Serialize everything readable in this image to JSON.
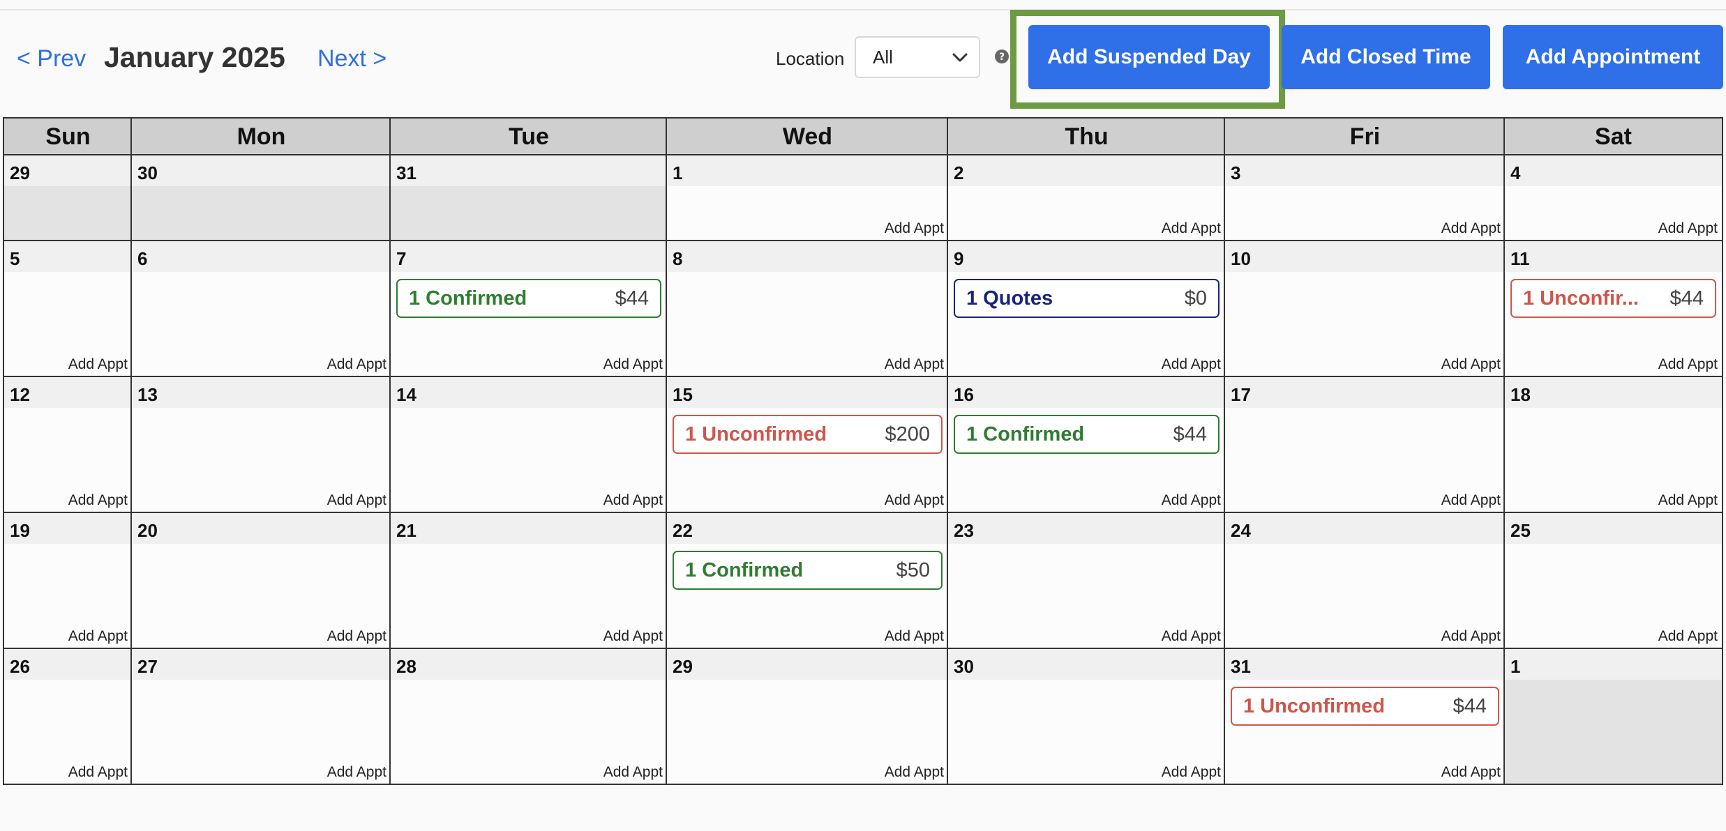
{
  "toolbar": {
    "prev_label": "< Prev",
    "month_title": "January 2025",
    "next_label": "Next >",
    "location_label": "Location",
    "location_value": "All",
    "help_icon": "question-circle-icon",
    "add_suspended_day_label": "Add Suspended Day",
    "add_closed_time_label": "Add Closed Time",
    "add_appointment_label": "Add Appointment"
  },
  "colors": {
    "primary_button": "#2f6fe8",
    "highlight_frame": "#6e9a43",
    "confirmed": "#2e7d32",
    "quotes": "#1a237e",
    "unconfirmed": "#d0554a",
    "link": "#2f6fe0"
  },
  "calendar": {
    "weekdays": [
      "Sun",
      "Mon",
      "Tue",
      "Wed",
      "Thu",
      "Fri",
      "Sat"
    ],
    "add_appt_label": "Add Appt",
    "weeks": [
      [
        {
          "day": "29",
          "outside": true
        },
        {
          "day": "30",
          "outside": true
        },
        {
          "day": "31",
          "outside": true
        },
        {
          "day": "1",
          "outside": false
        },
        {
          "day": "2",
          "outside": false
        },
        {
          "day": "3",
          "outside": false
        },
        {
          "day": "4",
          "outside": false
        }
      ],
      [
        {
          "day": "5",
          "outside": false
        },
        {
          "day": "6",
          "outside": false
        },
        {
          "day": "7",
          "outside": false,
          "event": {
            "status": "confirmed",
            "label": "1 Confirmed",
            "amount": "$44"
          }
        },
        {
          "day": "8",
          "outside": false
        },
        {
          "day": "9",
          "outside": false,
          "event": {
            "status": "quotes",
            "label": "1 Quotes",
            "amount": "$0"
          }
        },
        {
          "day": "10",
          "outside": false
        },
        {
          "day": "11",
          "outside": false,
          "event": {
            "status": "unconfirmed",
            "label": "1 Unconfir...",
            "amount": "$44"
          }
        }
      ],
      [
        {
          "day": "12",
          "outside": false
        },
        {
          "day": "13",
          "outside": false
        },
        {
          "day": "14",
          "outside": false
        },
        {
          "day": "15",
          "outside": false,
          "event": {
            "status": "unconfirmed",
            "label": "1 Unconfirmed",
            "amount": "$200"
          }
        },
        {
          "day": "16",
          "outside": false,
          "event": {
            "status": "confirmed",
            "label": "1 Confirmed",
            "amount": "$44"
          }
        },
        {
          "day": "17",
          "outside": false
        },
        {
          "day": "18",
          "outside": false
        }
      ],
      [
        {
          "day": "19",
          "outside": false
        },
        {
          "day": "20",
          "outside": false
        },
        {
          "day": "21",
          "outside": false
        },
        {
          "day": "22",
          "outside": false,
          "event": {
            "status": "confirmed",
            "label": "1 Confirmed",
            "amount": "$50"
          }
        },
        {
          "day": "23",
          "outside": false
        },
        {
          "day": "24",
          "outside": false
        },
        {
          "day": "25",
          "outside": false
        }
      ],
      [
        {
          "day": "26",
          "outside": false
        },
        {
          "day": "27",
          "outside": false
        },
        {
          "day": "28",
          "outside": false
        },
        {
          "day": "29",
          "outside": false
        },
        {
          "day": "30",
          "outside": false
        },
        {
          "day": "31",
          "outside": false,
          "event": {
            "status": "unconfirmed",
            "label": "1 Unconfirmed",
            "amount": "$44"
          }
        },
        {
          "day": "1",
          "outside": true
        }
      ]
    ]
  }
}
